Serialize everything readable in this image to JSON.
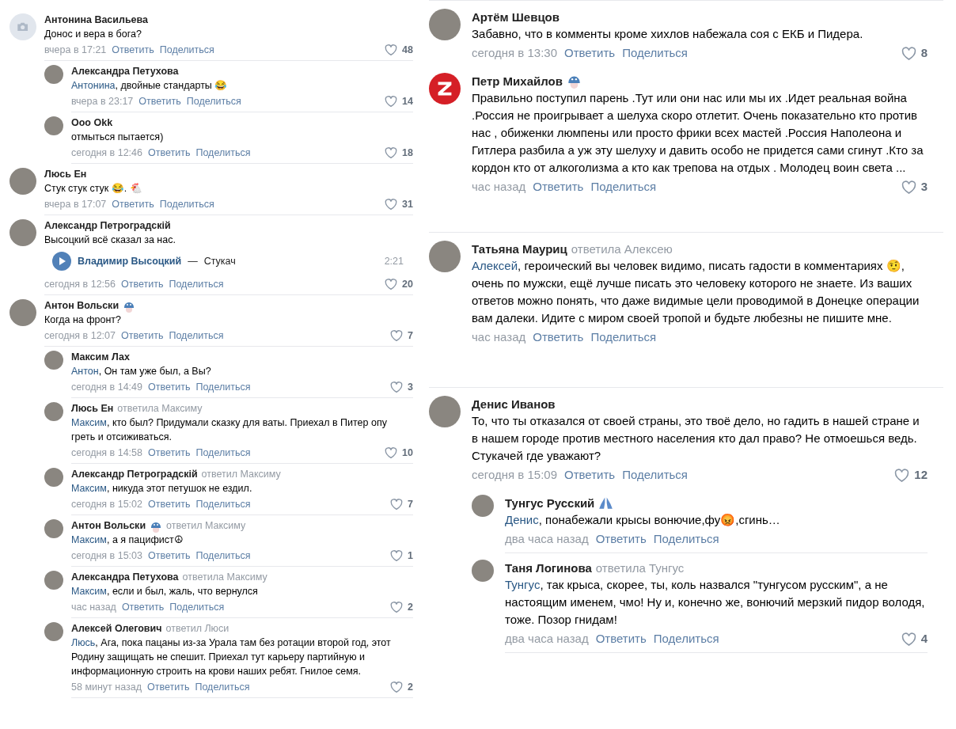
{
  "left_column": {
    "comments": [
      {
        "author": "Антонина Васильева",
        "avatar": {
          "kind": "camera"
        },
        "text": "Донос и вера в бога?",
        "time": "вчера в 17:21",
        "reply": "Ответить",
        "share": "Поделиться",
        "likes": "48",
        "replies": [
          {
            "author": "Александра Петухова",
            "avatar": {
              "kind": "photo"
            },
            "mention": "Антонина",
            "text": ", двойные стандарты 😂",
            "time": "вчера в 23:17",
            "reply": "Ответить",
            "share": "Поделиться",
            "likes": "14"
          },
          {
            "author": "Ooo Okk",
            "avatar": {
              "kind": "photo"
            },
            "text": "отмыться пытается)",
            "time": "сегодня в 12:46",
            "reply": "Ответить",
            "share": "Поделиться",
            "likes": "18"
          }
        ]
      },
      {
        "author": "Люсь Ен",
        "avatar": {
          "kind": "photo"
        },
        "text": "Стук стук стук 😂. 🐔",
        "time": "вчера в 17:07",
        "reply": "Ответить",
        "share": "Поделиться",
        "likes": "31"
      },
      {
        "author": "Александр Петроградскій",
        "avatar": {
          "kind": "photo"
        },
        "text": "Высоцкий всё сказал за нас.",
        "attachment": {
          "artist": "Владимир Высоцкий",
          "separator": "—",
          "title": "Стукач",
          "duration": "2:21"
        },
        "time": "сегодня в 12:56",
        "reply": "Ответить",
        "share": "Поделиться",
        "likes": "20"
      },
      {
        "author": "Антон Вольски",
        "badge": {
          "kind": "helmet"
        },
        "avatar": {
          "kind": "photo"
        },
        "text": "Когда на фронт?",
        "time": "сегодня в 12:07",
        "reply": "Ответить",
        "share": "Поделиться",
        "likes": "7",
        "replies": [
          {
            "author": "Максим Лах",
            "avatar": {
              "kind": "photo"
            },
            "mention": "Антон",
            "text": ", Он там уже был, а Вы?",
            "time": "сегодня в 14:49",
            "reply": "Ответить",
            "share": "Поделиться",
            "likes": "3"
          },
          {
            "author": "Люсь Ен",
            "reply_to": "ответила Максиму",
            "avatar": {
              "kind": "photo"
            },
            "mention": "Максим",
            "text": ", кто был? Придумали сказку для ваты. Приехал в Питер опу греть и отсиживаться.",
            "time": "сегодня в 14:58",
            "reply": "Ответить",
            "share": "Поделиться",
            "likes": "10"
          },
          {
            "author": "Александр Петроградскій",
            "reply_to": "ответил Максиму",
            "avatar": {
              "kind": "photo"
            },
            "mention": "Максим",
            "text": ", никуда этот петушок не ездил.",
            "time": "сегодня в 15:02",
            "reply": "Ответить",
            "share": "Поделиться",
            "likes": "7"
          },
          {
            "author": "Антон Вольски",
            "badge": {
              "kind": "helmet"
            },
            "reply_to": "ответил Максиму",
            "avatar": {
              "kind": "photo"
            },
            "mention": "Максим",
            "text": ", а я пацифист☮",
            "time": "сегодня в 15:03",
            "reply": "Ответить",
            "share": "Поделиться",
            "likes": "1"
          },
          {
            "author": "Александра Петухова",
            "reply_to": "ответила Максиму",
            "avatar": {
              "kind": "photo"
            },
            "mention": "Максим",
            "text": ", если и был, жаль, что вернулся",
            "time": "час назад",
            "reply": "Ответить",
            "share": "Поделиться",
            "likes": "2"
          },
          {
            "author": "Алексей Олегович",
            "reply_to": "ответил Люси",
            "avatar": {
              "kind": "photo"
            },
            "mention": "Люсь",
            "text": ", Ага, пока пацаны из-за Урала там без ротации второй год, этот Родину защищать не спешит. Приехал тут карьеру партийную и информационную строить на крови наших ребят. Гнилое семя.",
            "time": "58 минут назад",
            "reply": "Ответить",
            "share": "Поделиться",
            "likes": "2"
          }
        ]
      }
    ]
  },
  "right_column": {
    "sections": [
      {
        "comments": [
          {
            "author": "Артём Шевцов",
            "avatar": {
              "kind": "photo"
            },
            "text": "Забавно, что в комменты кроме хихлов набежала соя с ЕКБ и Пидера.",
            "time": "сегодня в 13:30",
            "reply": "Ответить",
            "share": "Поделиться",
            "likes": "8"
          },
          {
            "author": "Петр Михайлов",
            "badge": {
              "kind": "helmet"
            },
            "avatar": {
              "kind": "z"
            },
            "text": "Правильно поступил парень .Тут или они нас или мы их .Идет реальная война .Россия не проигрывает а шелуха скоро отлетит. Очень показательно кто против нас , обиженки люмпены или просто фрики всех мастей .Россия Наполеона и Гитлера разбила а уж эту шелуху и давить особо не придется сами сгинут .Кто за кордон кто от алкоголизма а кто как трепова на отдых . Молодец воин света ...",
            "time": "час назад",
            "reply": "Ответить",
            "share": "Поделиться",
            "likes": "3"
          }
        ]
      },
      {
        "comments": [
          {
            "author": "Татьяна Мауриц",
            "reply_to": "ответила Алексею",
            "avatar": {
              "kind": "photo"
            },
            "mention": "Алексей",
            "text": ", героический вы человек видимо, писать гадости в комментариях 🤨, очень по мужски, ещё лучше писать это человеку которого не знаете. Из ваших ответов можно понять, что даже видимые цели проводимой в Донецке операции вам далеки. Идите с миром своей тропой и будьте любезны не пишите мне.",
            "time": "час назад",
            "reply": "Ответить",
            "share": "Поделиться"
          }
        ]
      },
      {
        "comments": [
          {
            "author": "Денис Иванов",
            "avatar": {
              "kind": "photo"
            },
            "text": "То, что ты отказался от своей страны, это твоё дело, но гадить в нашей стране и в нашем городе против местного населения кто дал право? Не отмоешься ведь. Стукачей где уважают?",
            "time": "сегодня в 15:09",
            "reply": "Ответить",
            "share": "Поделиться",
            "likes": "12",
            "replies": [
              {
                "author": "Тунгус Русский",
                "badge": {
                  "kind": "hands"
                },
                "avatar": {
                  "kind": "photo"
                },
                "mention": "Денис",
                "text": ", понабежали крысы вонючие,фу😡,сгинь…",
                "time": "два часа назад",
                "reply": "Ответить",
                "share": "Поделиться"
              },
              {
                "author": "Таня Логинова",
                "reply_to": "ответила Тунгус",
                "avatar": {
                  "kind": "photo"
                },
                "mention": "Тунгус",
                "text": ", так крыса, скорее, ты, коль назвался \"тунгусом русским\", а не настоящим именем, чмо! Ну и, конечно же, вонючий мерзкий пидор володя, тоже. Позор гнидам!",
                "time": "два часа назад",
                "reply": "Ответить",
                "share": "Поделиться",
                "likes": "4"
              }
            ]
          }
        ]
      }
    ]
  }
}
